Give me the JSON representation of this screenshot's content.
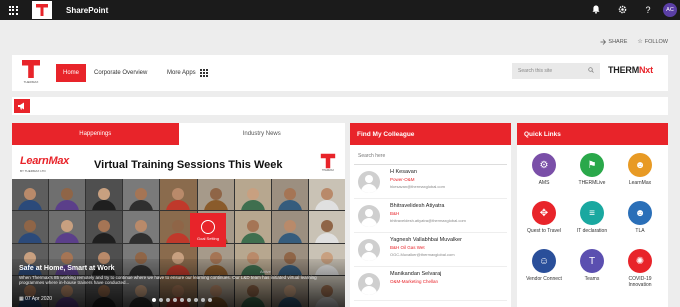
{
  "suite": {
    "title": "SharePoint",
    "avatar_initials": "AC",
    "icons": [
      "bell-icon",
      "gear-icon",
      "help-icon"
    ]
  },
  "actions": {
    "share": "SHARE",
    "follow": "FOLLOW"
  },
  "header": {
    "logo_word": "THERMAX",
    "nav": {
      "home": "Home",
      "corporate": "Corporate Overview",
      "more_apps": "More Apps"
    },
    "search_placeholder": "Search this site",
    "brand": {
      "prefix": "THERM",
      "suffix": "Nxt"
    }
  },
  "news": {
    "tabs": [
      "Happenings",
      "Industry News"
    ],
    "banner": {
      "brand": "LearnMax",
      "brand_tag": "BY THERMAX LTD",
      "title": "Virtual Training Sessions This Week",
      "goal_label": "Goal Setting",
      "active_label": "Active"
    },
    "story": {
      "title": "Safe at Home, Smart at Work",
      "text": "When Thermax's 85 working remotely and try to continue where we have to ensure our learning continues. Our L&D team has initiated virtual learning programmes where in-house trainers have conducted...",
      "date": "07 Apr 2020"
    },
    "slide_count": 9,
    "active_slide": 0
  },
  "colleague": {
    "title": "Find My Colleague",
    "search_placeholder": "Search here",
    "people": [
      {
        "name": "H Kesavan",
        "dept": "Power-O&M",
        "email": "hkesavan@thermaxglobal.com"
      },
      {
        "name": "Bhitravelidesh Atiyatra",
        "dept": "B&H",
        "email": "bhitraveldesh.atiyatra@thermaxglobal.com"
      },
      {
        "name": "Yagnesh Vallabhbai Muvalker",
        "dept": "B&H Oil Gas Wet",
        "email": "OGC-Muvalker@thermaxglobal.com"
      },
      {
        "name": "Manikandan Selvaraj",
        "dept": "O&M-Marketing Chellan",
        "email": ""
      }
    ]
  },
  "quick_links": {
    "title": "Quick Links",
    "items": [
      {
        "label": "AMS",
        "color": "#7a4fa8",
        "icon": "gear-icon",
        "glyph": "⚙"
      },
      {
        "label": "THERMLive",
        "color": "#2aa84a",
        "icon": "flag-icon",
        "glyph": "⚑"
      },
      {
        "label": "LearnMax",
        "color": "#e89a24",
        "icon": "people-icon",
        "glyph": "☻"
      },
      {
        "label": "Quest to Travel",
        "color": "#e8242a",
        "icon": "compass-icon",
        "glyph": "✥"
      },
      {
        "label": "IT declaration",
        "color": "#1aa8a0",
        "icon": "document-icon",
        "glyph": "≡"
      },
      {
        "label": "TLA",
        "color": "#2a6fb8",
        "icon": "people-group-icon",
        "glyph": "☻"
      },
      {
        "label": "Vendor Connect",
        "color": "#2a4f9a",
        "icon": "person-icon",
        "glyph": "☺"
      },
      {
        "label": "Teams",
        "color": "#5b4fb0",
        "icon": "teams-icon",
        "glyph": "T"
      },
      {
        "label": "COVID-19 Innovation",
        "color": "#e8242a",
        "icon": "virus-icon",
        "glyph": "✺"
      }
    ]
  },
  "colors": {
    "brand_red": "#e8242a",
    "suite_bar": "#1b1b1b",
    "page_bg": "#ededed"
  }
}
